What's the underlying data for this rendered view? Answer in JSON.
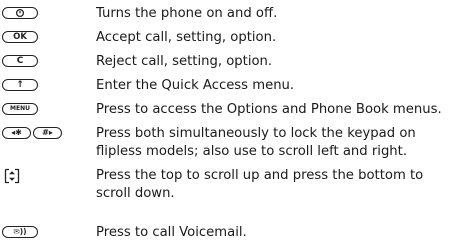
{
  "keys": [
    {
      "icon": "power-key-icon",
      "glyph": "⊙",
      "description": "Turns the phone on and off."
    },
    {
      "icon": "ok-key-icon",
      "glyph": "OK",
      "description": "Accept call, setting, option."
    },
    {
      "icon": "clear-key-icon",
      "glyph": "C",
      "description": "Reject call, setting, option."
    },
    {
      "icon": "up-arrow-key-icon",
      "glyph": "↑",
      "description": "Enter the Quick Access menu."
    },
    {
      "icon": "menu-key-icon",
      "glyph": "MENU",
      "description": "Press to access the Options and Phone Book menus."
    },
    {
      "icon": "star-hash-keys-icon",
      "glyph_left": "◂✱",
      "glyph_right": "#▸",
      "description_line1": "Press both simultaneously to lock the keypad on",
      "description_line2": "flipless models; also use to scroll left and right."
    },
    {
      "icon": "scroll-key-icon",
      "description_line1": "Press the top to scroll up and press the bottom to",
      "description_line2": "scroll down."
    },
    {
      "icon": "voicemail-key-icon",
      "glyph": "✉))",
      "description": "Press to call Voicemail."
    }
  ]
}
